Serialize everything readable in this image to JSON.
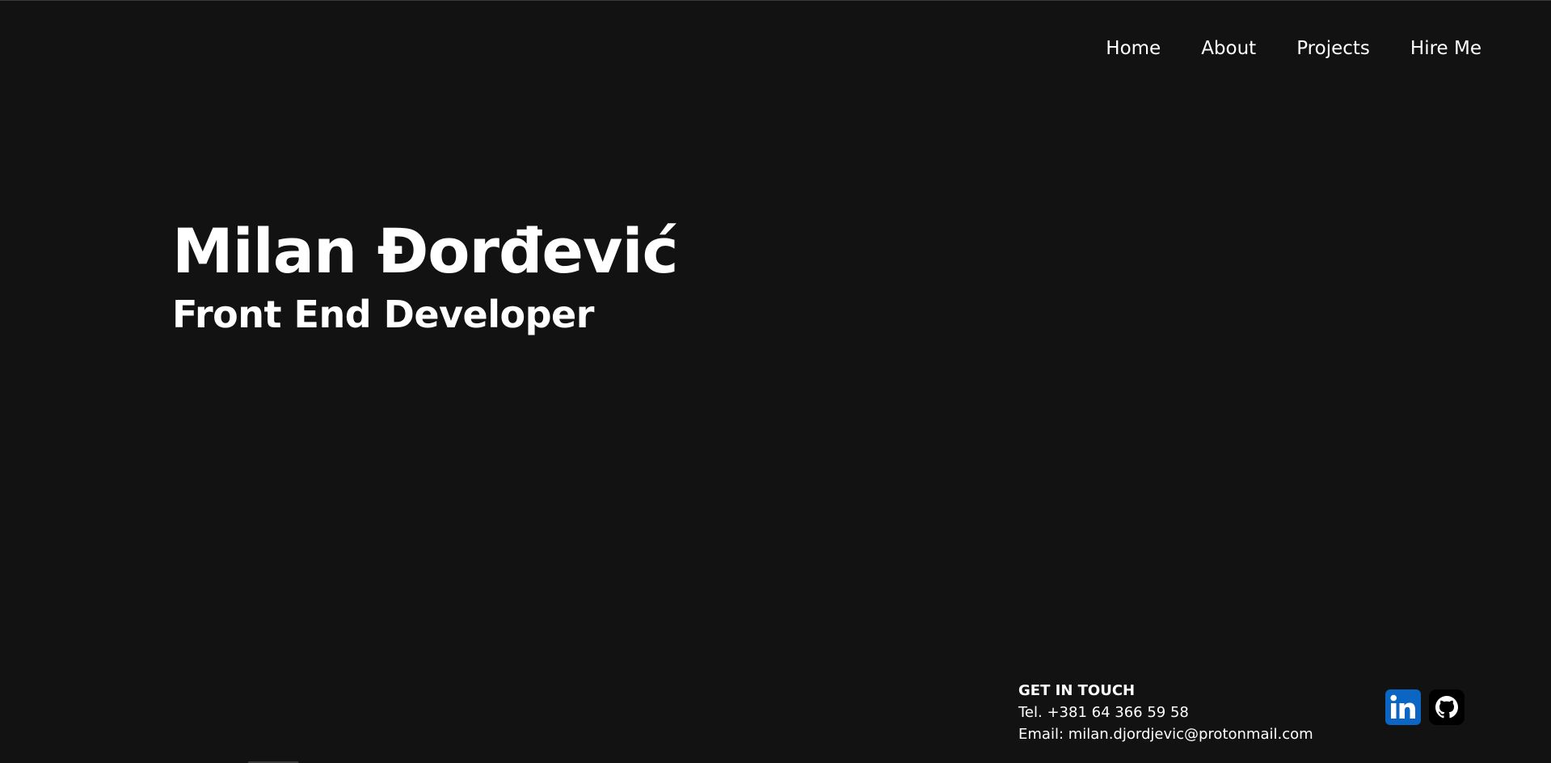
{
  "nav": {
    "items": [
      {
        "label": "Home"
      },
      {
        "label": "About"
      },
      {
        "label": "Projects"
      },
      {
        "label": "Hire Me"
      }
    ]
  },
  "hero": {
    "name": "Milan Đorđević",
    "role": "Front End Developer"
  },
  "contact": {
    "heading": "GET IN TOUCH",
    "phone": "Tel. +381 64 366 59 58",
    "email": "Email: milan.djordjevic@protonmail.com"
  },
  "socials": [
    {
      "icon": "linkedin-icon",
      "color": "#0a66c2"
    },
    {
      "icon": "github-icon",
      "color": "#000000"
    }
  ],
  "colors": {
    "background": "#121212",
    "text": "#ffffff"
  }
}
